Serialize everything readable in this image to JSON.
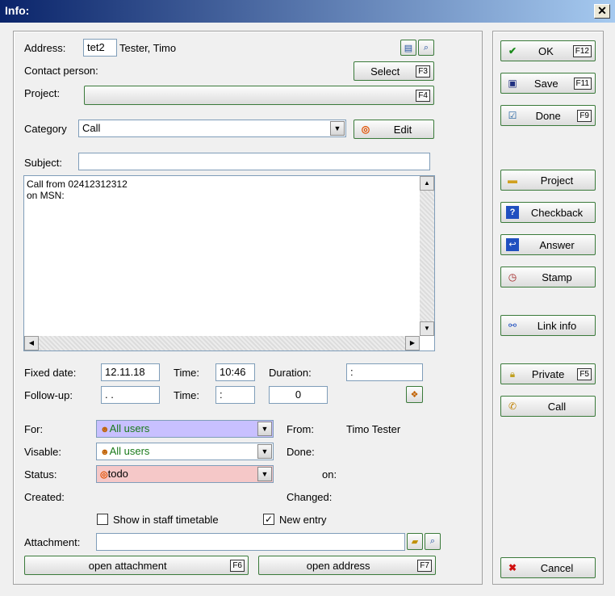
{
  "window": {
    "title": "Info:",
    "close_glyph": "✕"
  },
  "address": {
    "label": "Address:",
    "code": "tet2",
    "name": "Tester, Timo"
  },
  "contact": {
    "label": "Contact person:",
    "select_label": "Select",
    "select_key": "F3"
  },
  "project": {
    "label": "Project:",
    "key": "F4"
  },
  "category": {
    "label": "Category",
    "value": "Call",
    "edit_label": "Edit"
  },
  "subject": {
    "label": "Subject:",
    "value": ""
  },
  "notes": {
    "line1": "Call from 02412312312",
    "line2": "on MSN:"
  },
  "dates": {
    "fixed_label": "Fixed date:",
    "fixed_value": "12.11.18",
    "time_label": "Time:",
    "time_value": "10:46",
    "duration_label": "Duration:",
    "duration_value": ":",
    "followup_label": "Follow-up:",
    "followup_value": ". .",
    "followup_time_label": "Time:",
    "followup_time_value": ":",
    "followup_count": "0"
  },
  "for": {
    "label": "For:",
    "value": "All users",
    "from_label": "From:",
    "from_value": "Timo Tester"
  },
  "visible": {
    "label": "Visable:",
    "value": "All users",
    "done_label": "Done:"
  },
  "status": {
    "label": "Status:",
    "value": "todo",
    "on_label": "on:"
  },
  "created": {
    "label": "Created:",
    "changed_label": "Changed:"
  },
  "options": {
    "staff_label": "Show in staff timetable",
    "new_entry_label": "New entry",
    "new_entry_checked": "✓"
  },
  "attachment": {
    "label": "Attachment:",
    "value": "",
    "open_attachment": "open attachment",
    "open_attachment_key": "F6",
    "open_address": "open address",
    "open_address_key": "F7"
  },
  "side": {
    "ok": "OK",
    "ok_key": "F12",
    "save": "Save",
    "save_key": "F11",
    "done": "Done",
    "done_key": "F9",
    "project": "Project",
    "checkback": "Checkback",
    "answer": "Answer",
    "stamp": "Stamp",
    "link_info": "Link info",
    "private": "Private",
    "private_key": "F5",
    "call": "Call",
    "cancel": "Cancel"
  },
  "colors": {
    "for_bg": "#c8c0ff",
    "status_bg": "#f5c8c8",
    "green_text": "#1a7a1a"
  }
}
